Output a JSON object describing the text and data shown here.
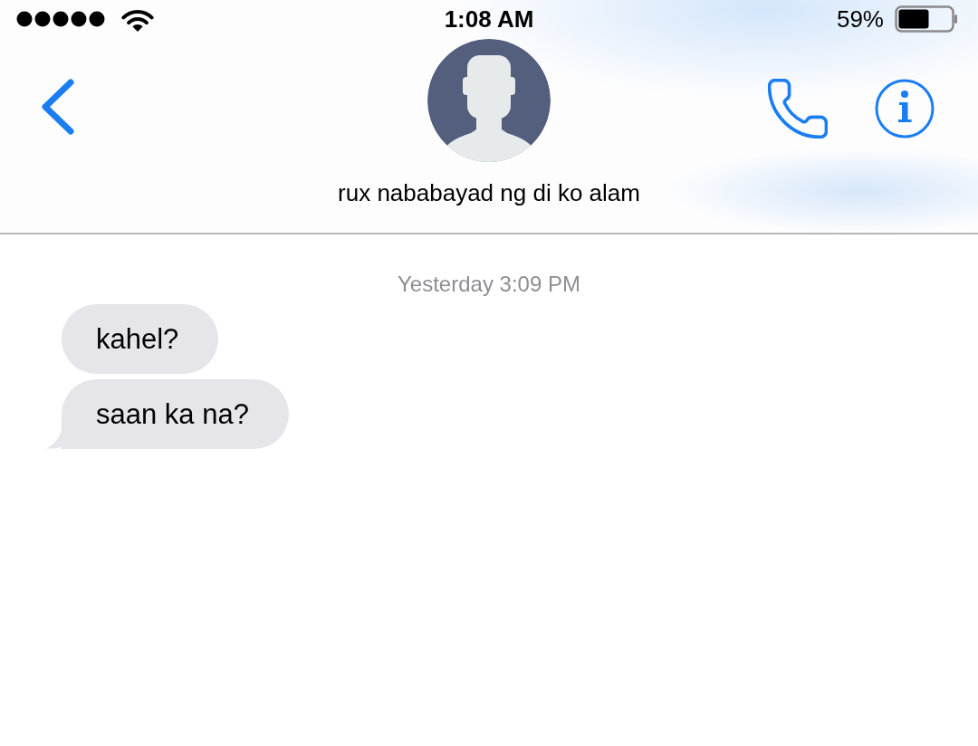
{
  "status_bar": {
    "time": "1:08 AM",
    "battery": "59%"
  },
  "header": {
    "contact_name": "rux nababayad ng di ko alam"
  },
  "conversation": {
    "timestamp": "Yesterday 3:09 PM",
    "messages": [
      {
        "text": "kahel?",
        "tail": false
      },
      {
        "text": "saan ka na?",
        "tail": true
      }
    ]
  }
}
